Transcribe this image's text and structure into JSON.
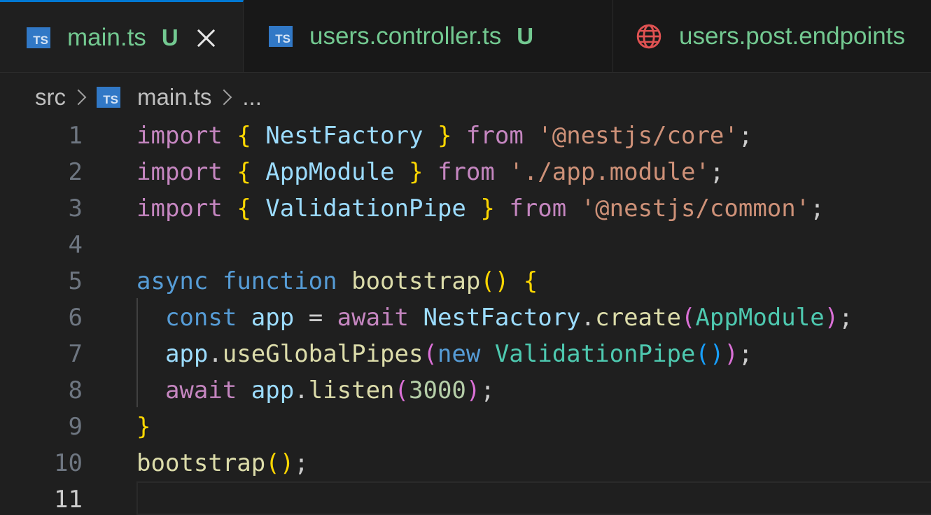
{
  "tabs": [
    {
      "label": "main.ts",
      "status": "U",
      "icon": "typescript-icon",
      "active": true,
      "closable": true
    },
    {
      "label": "users.controller.ts",
      "status": "U",
      "icon": "typescript-icon",
      "active": false
    },
    {
      "label": "users.post.endpoints",
      "icon": "globe-icon",
      "active": false
    }
  ],
  "icons": {
    "ts_label": "TS"
  },
  "breadcrumb": {
    "folder": "src",
    "file": "main.ts",
    "more": "..."
  },
  "editor": {
    "current_line": 11,
    "line_numbers": [
      "1",
      "2",
      "3",
      "4",
      "5",
      "6",
      "7",
      "8",
      "9",
      "10",
      "11"
    ],
    "lines": [
      [
        [
          "kw-ctrl",
          "import"
        ],
        [
          "punc",
          " "
        ],
        [
          "p1",
          "{"
        ],
        [
          "punc",
          " "
        ],
        [
          "var",
          "NestFactory"
        ],
        [
          "punc",
          " "
        ],
        [
          "p1",
          "}"
        ],
        [
          "punc",
          " "
        ],
        [
          "kw-ctrl",
          "from"
        ],
        [
          "punc",
          " "
        ],
        [
          "str",
          "'@nestjs/core'"
        ],
        [
          "punc",
          ";"
        ]
      ],
      [
        [
          "kw-ctrl",
          "import"
        ],
        [
          "punc",
          " "
        ],
        [
          "p1",
          "{"
        ],
        [
          "punc",
          " "
        ],
        [
          "var",
          "AppModule"
        ],
        [
          "punc",
          " "
        ],
        [
          "p1",
          "}"
        ],
        [
          "punc",
          " "
        ],
        [
          "kw-ctrl",
          "from"
        ],
        [
          "punc",
          " "
        ],
        [
          "str",
          "'./app.module'"
        ],
        [
          "punc",
          ";"
        ]
      ],
      [
        [
          "kw-ctrl",
          "import"
        ],
        [
          "punc",
          " "
        ],
        [
          "p1",
          "{"
        ],
        [
          "punc",
          " "
        ],
        [
          "var",
          "ValidationPipe"
        ],
        [
          "punc",
          " "
        ],
        [
          "p1",
          "}"
        ],
        [
          "punc",
          " "
        ],
        [
          "kw-ctrl",
          "from"
        ],
        [
          "punc",
          " "
        ],
        [
          "str",
          "'@nestjs/common'"
        ],
        [
          "punc",
          ";"
        ]
      ],
      [],
      [
        [
          "kw",
          "async"
        ],
        [
          "punc",
          " "
        ],
        [
          "kw",
          "function"
        ],
        [
          "punc",
          " "
        ],
        [
          "fn",
          "bootstrap"
        ],
        [
          "p1",
          "()"
        ],
        [
          "punc",
          " "
        ],
        [
          "p1",
          "{"
        ]
      ],
      [
        [
          "punc",
          "  "
        ],
        [
          "kw",
          "const"
        ],
        [
          "punc",
          " "
        ],
        [
          "var",
          "app"
        ],
        [
          "punc",
          " = "
        ],
        [
          "kw-ctrl",
          "await"
        ],
        [
          "punc",
          " "
        ],
        [
          "var",
          "NestFactory"
        ],
        [
          "punc",
          "."
        ],
        [
          "fn",
          "create"
        ],
        [
          "p2",
          "("
        ],
        [
          "cls",
          "AppModule"
        ],
        [
          "p2",
          ")"
        ],
        [
          "punc",
          ";"
        ]
      ],
      [
        [
          "punc",
          "  "
        ],
        [
          "var",
          "app"
        ],
        [
          "punc",
          "."
        ],
        [
          "fn",
          "useGlobalPipes"
        ],
        [
          "p2",
          "("
        ],
        [
          "kw",
          "new"
        ],
        [
          "punc",
          " "
        ],
        [
          "cls",
          "ValidationPipe"
        ],
        [
          "p3",
          "()"
        ],
        [
          "p2",
          ")"
        ],
        [
          "punc",
          ";"
        ]
      ],
      [
        [
          "punc",
          "  "
        ],
        [
          "kw-ctrl",
          "await"
        ],
        [
          "punc",
          " "
        ],
        [
          "var",
          "app"
        ],
        [
          "punc",
          "."
        ],
        [
          "fn",
          "listen"
        ],
        [
          "p2",
          "("
        ],
        [
          "num",
          "3000"
        ],
        [
          "p2",
          ")"
        ],
        [
          "punc",
          ";"
        ]
      ],
      [
        [
          "p1",
          "}"
        ]
      ],
      [
        [
          "fn",
          "bootstrap"
        ],
        [
          "p1",
          "()"
        ],
        [
          "punc",
          ";"
        ]
      ],
      []
    ]
  }
}
